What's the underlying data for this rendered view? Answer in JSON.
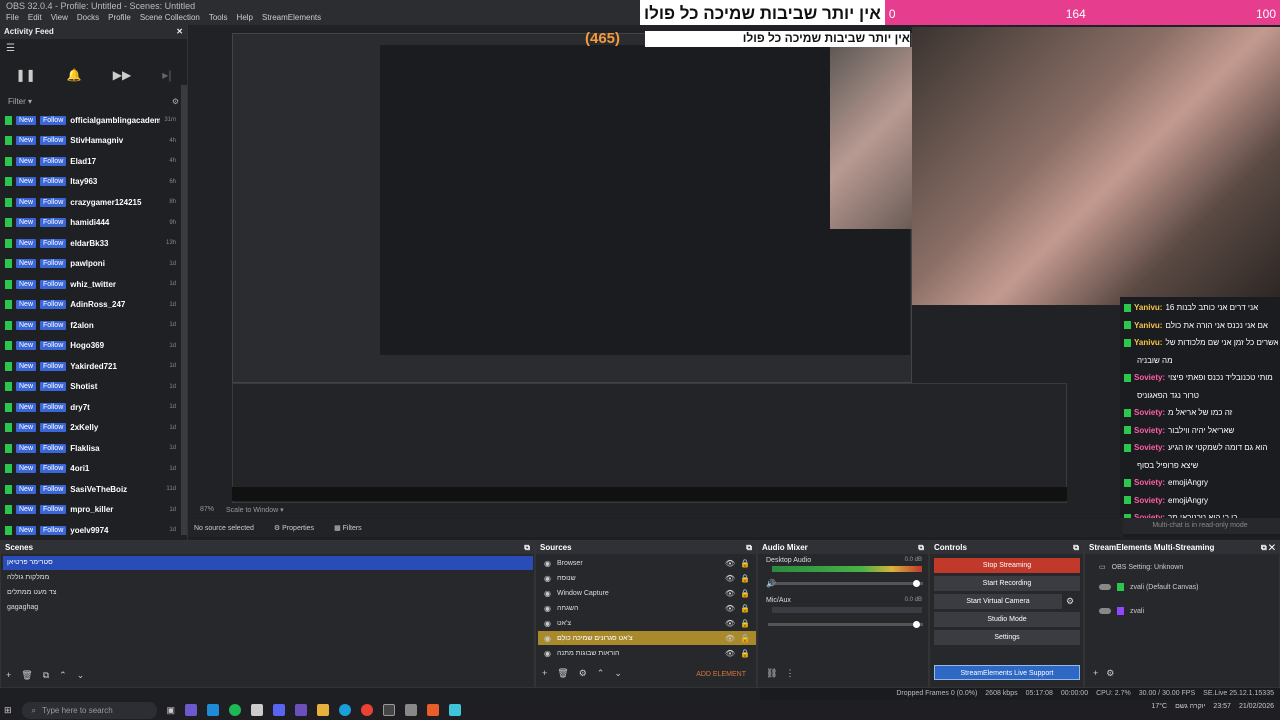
{
  "window": {
    "title": "OBS 32.0.4 - Profile: Untitled - Scenes: Untitled"
  },
  "menu": [
    "File",
    "Edit",
    "View",
    "Docks",
    "Profile",
    "Scene Collection",
    "Tools",
    "Help",
    "StreamElements"
  ],
  "overlay": {
    "text": "אין יותר שביבות שמיכה כל פולו",
    "count_left": "0",
    "count_mid": "164",
    "count_right": "100",
    "score": "(465)"
  },
  "activity_feed": {
    "title": "Activity Feed",
    "filter_label": "Filter",
    "badge": "New",
    "action": "Follow",
    "items": [
      {
        "name": "officialgamblingacademy",
        "ago": "31m"
      },
      {
        "name": "StivHamagniv",
        "ago": "4h"
      },
      {
        "name": "Elad17",
        "ago": "4h"
      },
      {
        "name": "Itay963",
        "ago": "6h"
      },
      {
        "name": "crazygamer124215",
        "ago": "8h"
      },
      {
        "name": "hamidi444",
        "ago": "9h"
      },
      {
        "name": "eldarBk33",
        "ago": "13h"
      },
      {
        "name": "pawlponi",
        "ago": "1d"
      },
      {
        "name": "whiz_twitter",
        "ago": "1d"
      },
      {
        "name": "AdinRoss_247",
        "ago": "1d"
      },
      {
        "name": "f2alon",
        "ago": "1d"
      },
      {
        "name": "Hogo369",
        "ago": "1d"
      },
      {
        "name": "Yakirded721",
        "ago": "1d"
      },
      {
        "name": "Shotist",
        "ago": "1d"
      },
      {
        "name": "dry7t",
        "ago": "1d"
      },
      {
        "name": "2xKelly",
        "ago": "1d"
      },
      {
        "name": "Flaklisa",
        "ago": "1d"
      },
      {
        "name": "4ori1",
        "ago": "1d"
      },
      {
        "name": "SasiVeTheBoiz",
        "ago": "11d"
      },
      {
        "name": "mpro_killer",
        "ago": "1d"
      },
      {
        "name": "yoelv9974",
        "ago": "1d"
      }
    ]
  },
  "chat": {
    "messages": [
      {
        "user": "Yanivu:",
        "text": "אני דרים אני כותב לבנות 16",
        "type": "y"
      },
      {
        "user": "Yanivu:",
        "text": "אם אני נכנס אני הורה את כולם",
        "type": "y"
      },
      {
        "user": "Yanivu:",
        "text": "ואשרים כל זמן אני שם מלכודות של",
        "type": "y"
      },
      {
        "user": "",
        "text": "מה שובניה",
        "type": "plain"
      },
      {
        "user": "Sovietу:",
        "text": "מותי טכנובליד נכנס ופאתי פיצוי",
        "type": "p"
      },
      {
        "user": "",
        "text": "טרור נגד הפאגוניס",
        "type": "plain"
      },
      {
        "user": "Sovietу:",
        "text": "זה כמו של אריאל מ",
        "type": "p"
      },
      {
        "user": "Sovietу:",
        "text": "שאריאל יהיה ווילבור",
        "type": "p"
      },
      {
        "user": "Sovietу:",
        "text": "הוא גם דומה לשמקטי אז הגיע",
        "type": "p"
      },
      {
        "user": "",
        "text": "שיצא פרופיל בסוף",
        "type": "plain"
      },
      {
        "user": "Sovietу:",
        "text": "emojiAngry",
        "type": "p"
      },
      {
        "user": "Sovietу:",
        "text": "emojiAngry",
        "type": "p"
      },
      {
        "user": "Sovietу:",
        "text": "כן כי הוא טכנוראי מר",
        "type": "p"
      }
    ],
    "readonly": "Multi-chat is in read-only mode"
  },
  "preview_footer": {
    "zoom": "87%",
    "scale": "Scale to Window"
  },
  "source_toolbar": {
    "no_source": "No source selected",
    "properties": "Properties",
    "filters": "Filters"
  },
  "scenes": {
    "title": "Scenes",
    "items": [
      "סטרימר פרטיאן",
      "ממלקות גוללה",
      "צד מעט ממתלים",
      "gagaghag"
    ]
  },
  "sources": {
    "title": "Sources",
    "items": [
      {
        "name": "Browser",
        "hl": false
      },
      {
        "name": "שנוסח",
        "hl": false
      },
      {
        "name": "Window Capture",
        "hl": false
      },
      {
        "name": "השגחה",
        "hl": false
      },
      {
        "name": "צ'אט",
        "hl": false
      },
      {
        "name": "צ'אט סגרונים שמיכה כולם",
        "hl": true
      },
      {
        "name": "הוראות שבוגות מתנה",
        "hl": false
      }
    ],
    "add_element": "ADD ELEMENT"
  },
  "mixer": {
    "title": "Audio Mixer",
    "channels": [
      {
        "name": "Desktop Audio",
        "db": "0.0 dB"
      },
      {
        "name": "Mic/Aux",
        "db": "0.0 dB"
      }
    ]
  },
  "controls": {
    "title": "Controls",
    "buttons": [
      "Stop Streaming",
      "Start Recording",
      "Start Virtual Camera",
      "Studio Mode",
      "Settings"
    ],
    "support": "StreamElements Live Support"
  },
  "se": {
    "title": "StreamElements Multi-Streaming",
    "setting": "OBS Setting: Unknown",
    "rows": [
      {
        "label": "zvali (Default Canvas)"
      },
      {
        "label": "zvali"
      }
    ]
  },
  "status": {
    "dropped": "Dropped Frames 0 (0.0%)",
    "kbps": "2608 kbps",
    "time": "05:17:08",
    "rec": "00:00:00",
    "cpu": "CPU: 2.7%",
    "fps": "30.00 / 30.00 FPS",
    "live": "SE.Live 25.12.1.15335"
  },
  "taskbar": {
    "search": "Type here to search",
    "weather": "17°C",
    "weather_text": "יוקרה גשם",
    "clock_time": "23:57",
    "clock_date": "21/02/2026"
  },
  "colors": {
    "accent_blue": "#284cb8",
    "twitch_green": "#2ac64e",
    "overlay_pink": "#e63d8e",
    "stream_red": "#c0392b"
  }
}
